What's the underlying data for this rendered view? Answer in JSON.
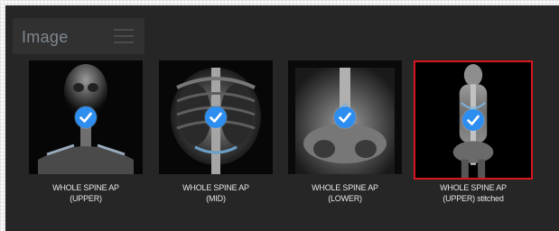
{
  "tab": {
    "label": "Image",
    "menu_icon": "menu-icon"
  },
  "thumbnails": [
    {
      "line1": "WHOLE SPINE AP",
      "line2": "(UPPER)",
      "selected": false,
      "region": "upper"
    },
    {
      "line1": "WHOLE SPINE AP",
      "line2": "(MID)",
      "selected": false,
      "region": "mid"
    },
    {
      "line1": "WHOLE SPINE AP",
      "line2": "(LOWER)",
      "selected": false,
      "region": "lower"
    },
    {
      "line1": "WHOLE SPINE AP",
      "line2": "(UPPER) stitched",
      "selected": true,
      "region": "full"
    }
  ],
  "colors": {
    "accent": "#2e8ef0",
    "selection": "#d7171f",
    "panel": "#262626"
  },
  "icons": {
    "check": "check-icon",
    "xray": "xray-image"
  }
}
